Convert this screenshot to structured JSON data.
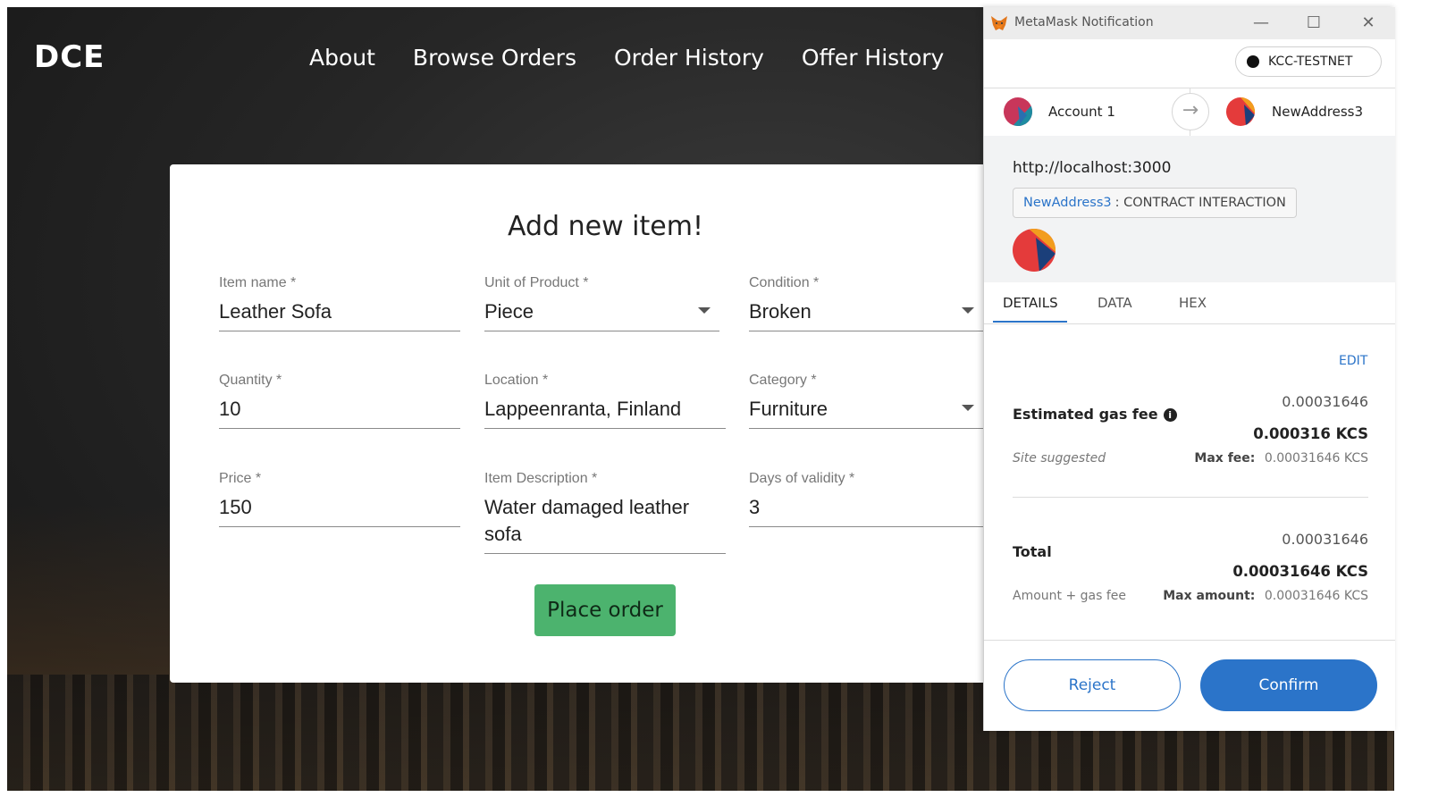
{
  "app": {
    "logo": "DCE",
    "nav": [
      "About",
      "Browse Orders",
      "Order History",
      "Offer History"
    ]
  },
  "form": {
    "title": "Add new item!",
    "fields": {
      "item_name": {
        "label": "Item name *",
        "value": "Leather Sofa"
      },
      "unit": {
        "label": "Unit of Product  *",
        "value": "Piece"
      },
      "condition": {
        "label": "Condition  *",
        "value": "Broken"
      },
      "quantity": {
        "label": "Quantity *",
        "value": "10"
      },
      "location": {
        "label": "Location *",
        "value": "Lappeenranta, Finland"
      },
      "category": {
        "label": "Category  *",
        "value": "Furniture"
      },
      "price": {
        "label": "Price *",
        "value": "150"
      },
      "description": {
        "label": "Item Description *",
        "value_line1": "Water damaged leather",
        "value_line2": "sofa"
      },
      "validity": {
        "label": "Days of validity *",
        "value": "3"
      }
    },
    "submit_label": "Place order"
  },
  "metamask": {
    "window_title": "MetaMask Notification",
    "network": "KCC-TESTNET",
    "from_account": "Account 1",
    "to_account": "NewAddress3",
    "origin": "http://localhost:3000",
    "interaction_address": "NewAddress3",
    "interaction_type": ": CONTRACT INTERACTION",
    "tabs": [
      "DETAILS",
      "DATA",
      "HEX"
    ],
    "edit_label": "EDIT",
    "gas": {
      "label": "Estimated gas fee",
      "value": "0.00031646",
      "value_kcs": "0.000316 KCS",
      "sub_label": "Site suggested",
      "max_label": "Max fee:",
      "max_value": "0.00031646 KCS"
    },
    "total": {
      "label": "Total",
      "value": "0.00031646",
      "value_kcs": "0.00031646 KCS",
      "sub_label": "Amount + gas fee",
      "max_label": "Max amount:",
      "max_value": "0.00031646 KCS"
    },
    "reject_label": "Reject",
    "confirm_label": "Confirm"
  },
  "colors": {
    "accent_blue": "#2b74c9",
    "place_order_green": "#4cb36e"
  }
}
